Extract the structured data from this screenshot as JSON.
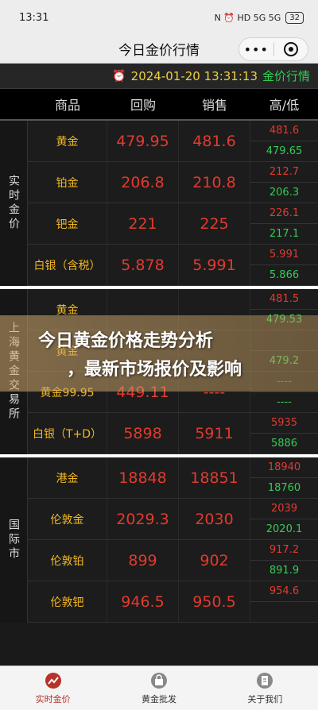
{
  "status": {
    "time": "13:31",
    "icons": "N ⏰ HD 5G 5G",
    "battery": "32"
  },
  "header": {
    "title": "今日金价行情",
    "more": "•••"
  },
  "date_bar": {
    "clock": "⏰",
    "datetime": "2024-01-20 13:31:13",
    "brand": "金价行情"
  },
  "columns": {
    "name": "商品",
    "buy": "回购",
    "sell": "销售",
    "hl": "高/低"
  },
  "sections": [
    {
      "label": "实时金价",
      "rows": [
        {
          "name": "黄金",
          "buy": "479.95",
          "sell": "481.6",
          "high": "481.6",
          "low": "479.65"
        },
        {
          "name": "铂金",
          "buy": "206.8",
          "sell": "210.8",
          "high": "212.7",
          "low": "206.3"
        },
        {
          "name": "钯金",
          "buy": "221",
          "sell": "225",
          "high": "226.1",
          "low": "217.1"
        },
        {
          "name": "白银（含税）",
          "buy": "5.878",
          "sell": "5.991",
          "high": "5.991",
          "low": "5.866"
        }
      ]
    },
    {
      "label": "上海黄金交易所",
      "rows": [
        {
          "name": "黄金",
          "buy": "",
          "sell": "",
          "high": "481.5",
          "low": "479.53"
        },
        {
          "name": "黄金",
          "buy": "",
          "sell": "",
          "high": "",
          "low": "479.2"
        },
        {
          "name": "黄金99.95",
          "buy": "449.11",
          "sell": "----",
          "high": "----",
          "low": "----"
        },
        {
          "name": "白银（T+D）",
          "buy": "5898",
          "sell": "5911",
          "high": "5935",
          "low": "5886"
        }
      ]
    },
    {
      "label": "国际市",
      "rows": [
        {
          "name": "港金",
          "buy": "18848",
          "sell": "18851",
          "high": "18940",
          "low": "18760"
        },
        {
          "name": "伦敦金",
          "buy": "2029.3",
          "sell": "2030",
          "high": "2039",
          "low": "2020.1"
        },
        {
          "name": "伦敦铂",
          "buy": "899",
          "sell": "902",
          "high": "917.2",
          "low": "891.9"
        },
        {
          "name": "伦敦钯",
          "buy": "946.5",
          "sell": "950.5",
          "high": "954.6",
          "low": ""
        }
      ]
    }
  ],
  "banner": {
    "line1": "今日黄金价格走势分析",
    "line2": "，最新市场报价及影响"
  },
  "nav": [
    {
      "label": "实时金价",
      "icon": "chart-icon"
    },
    {
      "label": "黄金批发",
      "icon": "bag-icon"
    },
    {
      "label": "关于我们",
      "icon": "doc-icon"
    }
  ],
  "colors": {
    "up": "#e23a2e",
    "down": "#33cc55",
    "gold": "#f2b820"
  }
}
